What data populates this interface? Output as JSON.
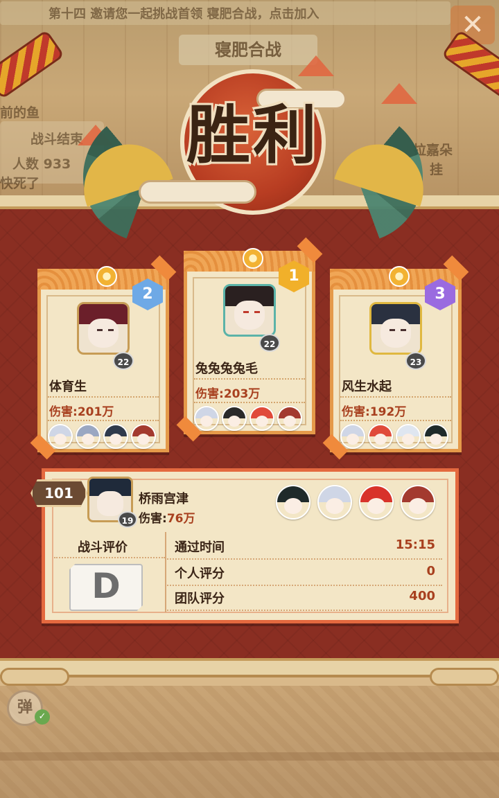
{
  "background": {
    "banner_text": "第十四 邀请您一起挑战首领 寝肥合战，点击加入",
    "title": "寝肥合战",
    "left_line1": "前的鱼",
    "left_line2": "战斗结束",
    "left_line3": "人数 933",
    "left_line4": "快死了",
    "right_line1": "拉嘉朵",
    "right_line2": "挂"
  },
  "victory": {
    "text": "胜利"
  },
  "top_players": [
    {
      "rank": "2",
      "name": "体育生",
      "damage_label": "伤害:",
      "damage_value": "201万",
      "level": "22",
      "hair": "#6b1f2a",
      "shikigami": [
        "#cfd6e6",
        "#9aa7c2",
        "#2f3a4c",
        "#a33a2f"
      ]
    },
    {
      "rank": "1",
      "name": "兔兔兔兔毛",
      "damage_label": "伤害:",
      "damage_value": "203万",
      "level": "22",
      "hair": "#2a2020",
      "shikigami": [
        "#cfd6e6",
        "#2a2a2a",
        "#e04a3a",
        "#a33a2f"
      ]
    },
    {
      "rank": "3",
      "name": "风生水起",
      "damage_label": "伤害:",
      "damage_value": "192万",
      "level": "23",
      "hair": "#2a3140",
      "shikigami": [
        "#cfd6e6",
        "#e04a3a",
        "#dfe6f0",
        "#1f2a2a"
      ]
    }
  ],
  "self": {
    "rank": "101",
    "name": "桥雨宫津",
    "damage_label": "伤害:",
    "damage_value": "76万",
    "level": "19",
    "shikigami": [
      "#1f2a2a",
      "#cfd6e6",
      "#d8322a",
      "#a33a2f"
    ],
    "evaluation_label": "战斗评价",
    "grade": "D",
    "stats": [
      {
        "label": "通过时间",
        "value": "15:15"
      },
      {
        "label": "个人评分",
        "value": "0"
      },
      {
        "label": "团队评分",
        "value": "400"
      }
    ]
  },
  "controls": {
    "danmaku_label": "弹",
    "close_label": "✕",
    "check": "✓"
  },
  "colors": {
    "panel": "#8a2e22",
    "card": "#f3e6c6",
    "accent": "#e59a4a",
    "damage": "#a8401f"
  }
}
